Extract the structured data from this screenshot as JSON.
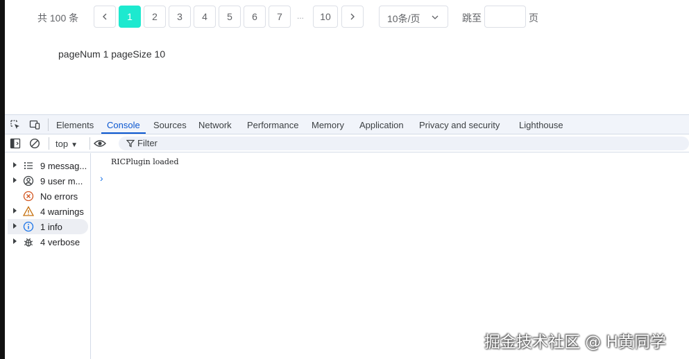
{
  "pagination": {
    "total_text": "共 100 条",
    "prev_icon": "chevron-left-icon",
    "pages": [
      "1",
      "2",
      "3",
      "4",
      "5",
      "6",
      "7"
    ],
    "current_page": "1",
    "ellipsis": "...",
    "last_page": "10",
    "next_icon": "chevron-right-icon",
    "page_size": "10条/页",
    "goto_label": "跳至",
    "goto_value": "",
    "page_suffix": "页",
    "accent_color": "#1de9cf"
  },
  "page_info": "pageNum 1 pageSize 10",
  "devtools": {
    "tabs": [
      "Elements",
      "Console",
      "Sources",
      "Network",
      "Performance",
      "Memory",
      "Application",
      "Privacy and security",
      "Lighthouse"
    ],
    "active_tab": "Console",
    "context": "top",
    "filter_placeholder": "Filter",
    "sidebar": [
      {
        "label": "9 messag...",
        "icon": "list-icon",
        "expandable": true
      },
      {
        "label": "9 user m...",
        "icon": "user-icon",
        "expandable": true
      },
      {
        "label": "No errors",
        "icon": "error-icon",
        "expandable": false
      },
      {
        "label": "4 warnings",
        "icon": "warning-icon",
        "expandable": true
      },
      {
        "label": "1 info",
        "icon": "info-icon",
        "expandable": true,
        "selected": true
      },
      {
        "label": "4 verbose",
        "icon": "bug-icon",
        "expandable": true
      }
    ],
    "log_messages": [
      "RICPlugin loaded"
    ],
    "prompt_symbol": "›"
  },
  "watermark": "掘金技术社区 @ H黄同学"
}
